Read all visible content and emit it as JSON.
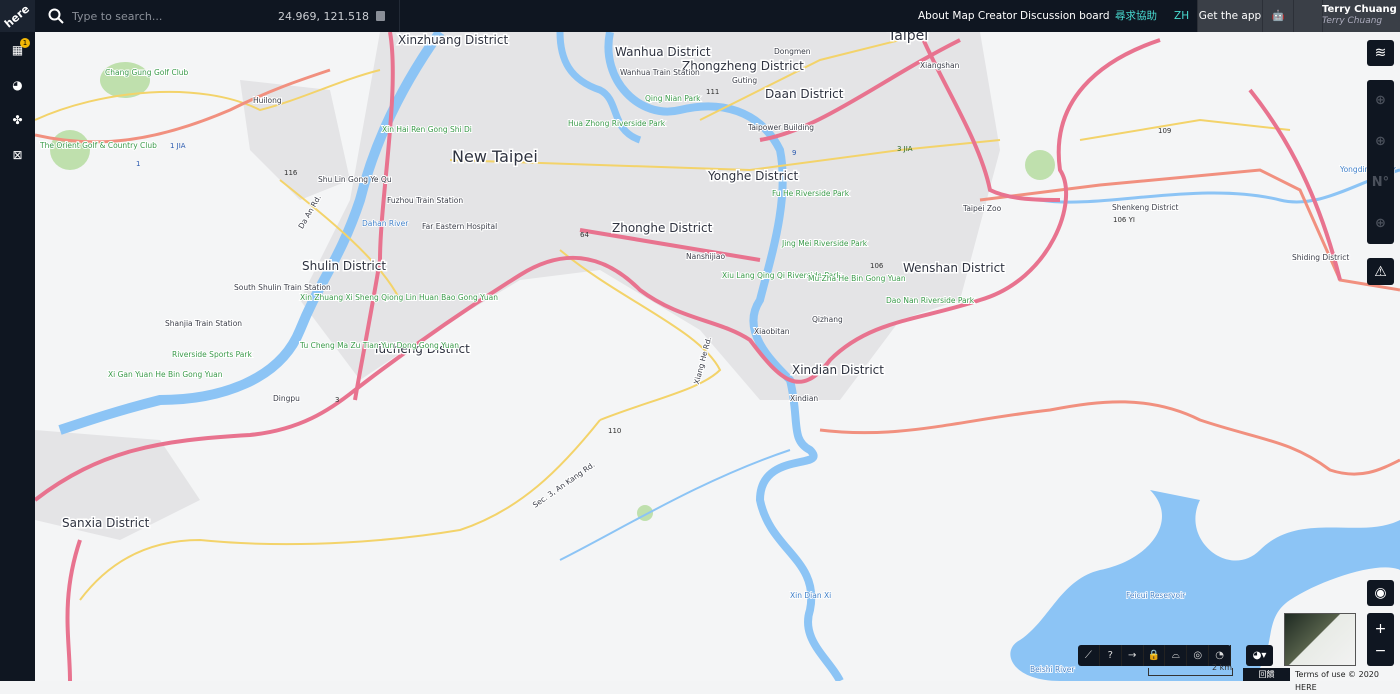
{
  "topbar": {
    "logo": "here",
    "search_placeholder": "Type to search...",
    "coordinates": "24.969, 121.518",
    "nav": [
      "About Map Creator",
      "Discussion board",
      "尋求協助",
      "ZH"
    ],
    "get_app": "Get the app",
    "user_name": "Terry Chuang",
    "user_sub": "Terry Chuang"
  },
  "sidebar": {
    "badge": "1",
    "items": [
      "calendar-icon",
      "pie-chart-icon",
      "community-icon",
      "map-icon"
    ]
  },
  "map": {
    "districts": [
      "Xinzhuang District",
      "Wanhua District",
      "Zhongzheng District",
      "Daan District",
      "Taipei",
      "New Taipei",
      "Yonghe District",
      "Zhonghe District",
      "Shulin District",
      "Wenshan District",
      "Tucheng District",
      "Xindian District",
      "Sanxia District",
      "Shenkeng District",
      "Shiding District"
    ],
    "places": [
      "Chang Gung Golf Club",
      "Huilong",
      "The Orient Golf & Country Club",
      "Shu Lin Gong Ye Qu",
      "Da An Rd.",
      "Fuzhou Train Station",
      "Far Eastern Hospital",
      "Xin Hai Ren Gong Shi Di",
      "South Shulin Train Station",
      "Shanjia Train Station",
      "Xin Zhuang Xi Sheng Qiong Lin Huan Bao Gong Yuan",
      "Tu Cheng Ma Zu Tian Yun Dong Gong Yuan",
      "Riverside Sports Park",
      "Dingpu",
      "Hua Zhong Riverside Park",
      "Qing Nian Park",
      "Taipower Building",
      "Fu He Riverside Park",
      "Nanshijiao",
      "Jing Mei Riverside Park",
      "Xiu Lang Qing Qi Riverside Park",
      "Mu Zha He Bin Gong Yuan",
      "Dao Nan Riverside Park",
      "Xiaobitan",
      "Qizhang",
      "Xindian",
      "Xiang He Rd.",
      "Sec. 3, An Kang Rd.",
      "Taipei Zoo",
      "Guting",
      "Dongmen",
      "Xiangshan",
      "Wanhua Train Station",
      "Xi Gan Yuan He Bin Gong Yuan"
    ],
    "water": [
      "Dahan River",
      "Yongding River",
      "Xin Dian Xi",
      "Feicui Reservoir",
      "Beishi River"
    ],
    "shields": [
      "3",
      "64",
      "110",
      "106",
      "3 JIA",
      "106 YI",
      "1",
      "1 JIA",
      "116",
      "9",
      "111",
      "109"
    ]
  },
  "controls": {
    "scale": "2 km",
    "feedback": "回饋",
    "terms": "Terms of use © 2020 HERE",
    "zoom_in": "+",
    "zoom_out": "−"
  },
  "colors": {
    "bar": "#0f1621",
    "highway": "#e8738f",
    "road": "#f3d36a",
    "water": "#8cc4f5",
    "park": "#b5dca0",
    "accent": "#48dad0"
  }
}
